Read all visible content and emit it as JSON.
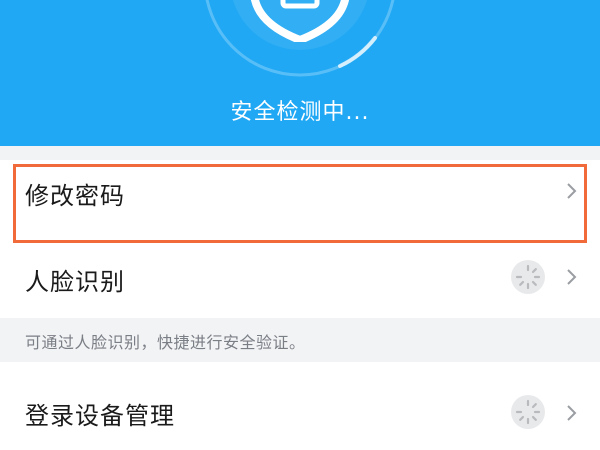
{
  "header": {
    "status_text": "安全检测中...",
    "icon": "shield-icon",
    "background_color": "#20a8f4"
  },
  "items": [
    {
      "label": "修改密码",
      "icon": "chevron-right-icon",
      "highlighted": true
    },
    {
      "label": "人脸识别",
      "icon": "chevron-right-icon",
      "loading": true
    },
    {
      "label": "登录设备管理",
      "icon": "chevron-right-icon",
      "loading": true
    }
  ],
  "hint": {
    "text": "可通过人脸识别，快捷进行安全验证。"
  },
  "colors": {
    "highlight_border": "#f06a3a",
    "page_background": "#f2f3f5"
  }
}
